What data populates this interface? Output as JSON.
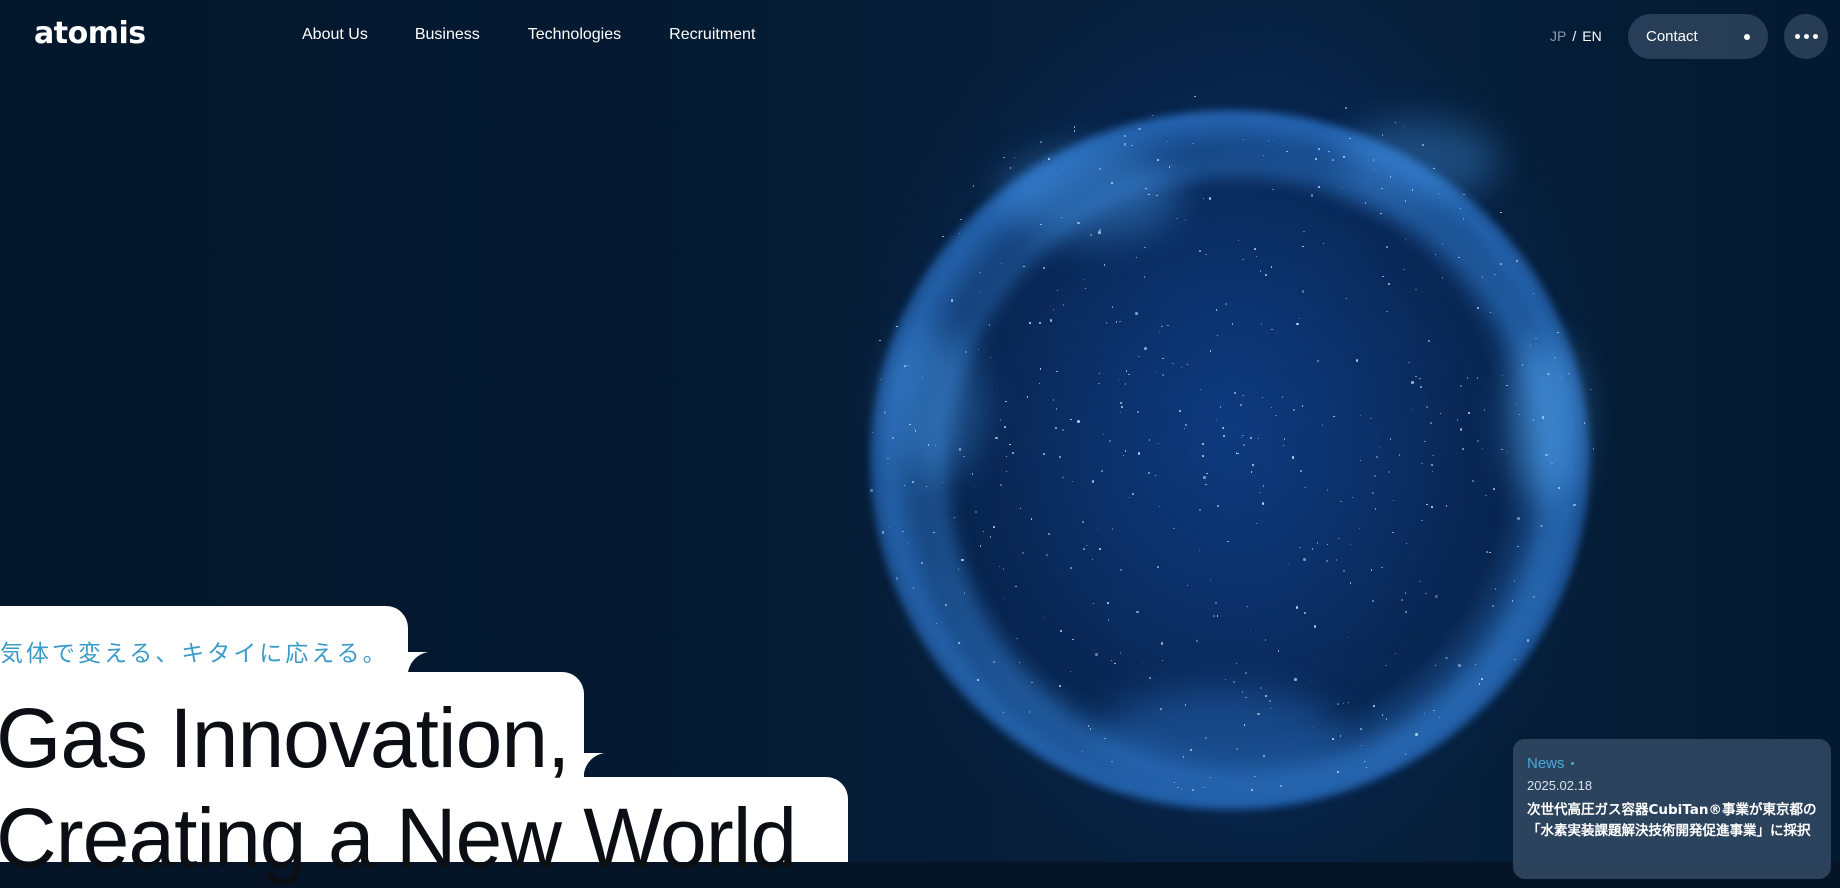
{
  "brand": {
    "logo_text": "atomis"
  },
  "nav": {
    "items": [
      {
        "label": "About Us"
      },
      {
        "label": "Business"
      },
      {
        "label": "Technologies"
      },
      {
        "label": "Recruitment"
      }
    ]
  },
  "language": {
    "jp": "JP",
    "separator": "/",
    "en": "EN",
    "active": "EN"
  },
  "contact": {
    "label": "Contact"
  },
  "menu": {
    "icon": "more-dots-icon"
  },
  "hero": {
    "tagline": "気体で変える、キタイに応える。",
    "headline_line1": "Gas Innovation,",
    "headline_line2": "Creating a New World"
  },
  "news": {
    "label": "News",
    "date": "2025.02.18",
    "title": "次世代高圧ガス容器CubiTan®事業が東京都の「水素実装課題解決技術開発促進事業」に採択"
  },
  "colors": {
    "background": "#051426",
    "accent": "#3a9bc8",
    "sphere": "#3c96ff"
  }
}
